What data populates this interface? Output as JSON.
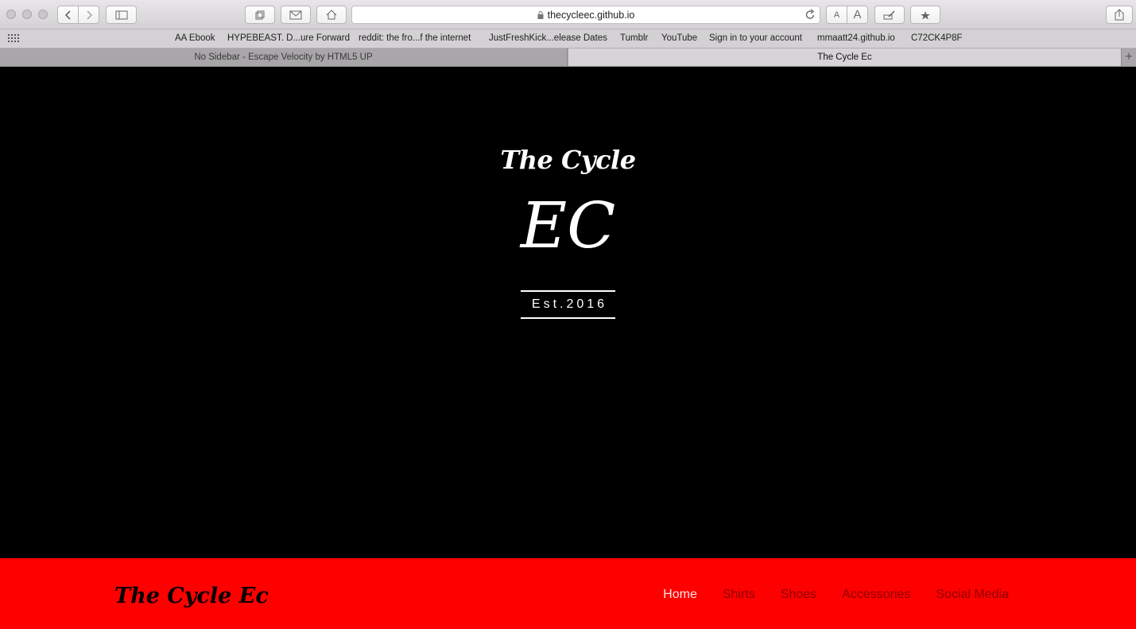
{
  "browser": {
    "url": "thecycleec.github.io",
    "bookmarks": [
      "AA Ebook",
      "HYPEBEAST. D...ure Forward",
      "reddit: the fro...f the internet",
      "JustFreshKick...elease Dates",
      "Tumblr",
      "YouTube",
      "Sign in to your account",
      "mmaatt24.github.io",
      "C72CK4P8F"
    ],
    "tabs": [
      {
        "label": "No Sidebar - Escape Velocity by HTML5 UP",
        "active": false
      },
      {
        "label": "The Cycle Ec",
        "active": true
      }
    ],
    "new_tab": "+"
  },
  "hero": {
    "logo_line1": "The Cycle",
    "logo_line2": "EC",
    "established": "Est.2016"
  },
  "navbar": {
    "brand": "The Cycle Ec",
    "items": [
      {
        "label": "Home",
        "current": true
      },
      {
        "label": "Shirts",
        "current": false
      },
      {
        "label": "Shoes",
        "current": false
      },
      {
        "label": "Accessories",
        "current": false
      },
      {
        "label": "Social Media",
        "current": false
      }
    ]
  },
  "colors": {
    "navbar_bg": "#ff0000",
    "hero_bg": "#000000",
    "nav_link": "#8a0000",
    "nav_current": "#ffe6e6"
  }
}
